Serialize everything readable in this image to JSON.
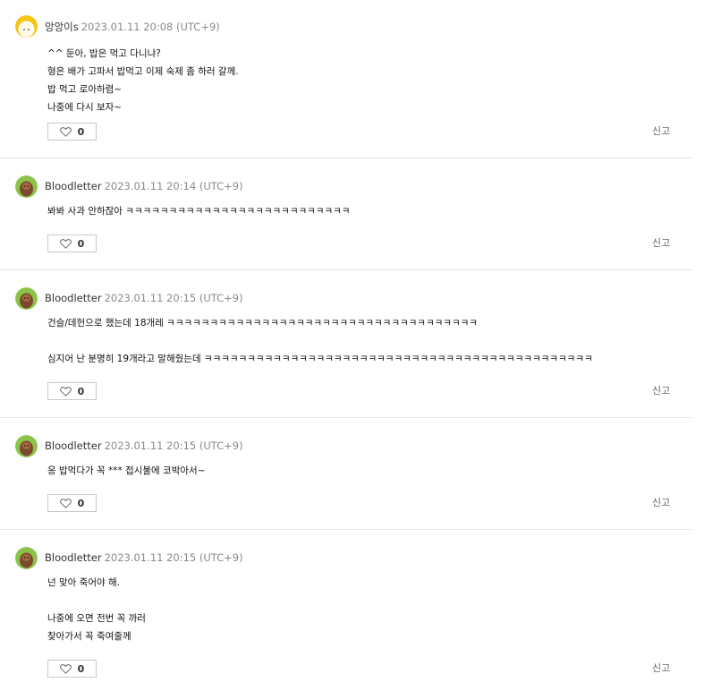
{
  "comments": [
    {
      "author": "앙앙이s",
      "timestamp": "2023.01.11 20:08 (UTC+9)",
      "avatar": "yellow-face-avatar",
      "lines": [
        "^^ 둔아, 밥은 먹고 다니냐?",
        "형은 배가 고파서 밥먹고 이제 숙제 좀 하러 갈께.",
        "밥 먹고 로아하렴~",
        "나중에 다시 보자~"
      ],
      "likes": "0",
      "report": "신고"
    },
    {
      "author": "Bloodletter",
      "timestamp": "2023.01.11 20:14 (UTC+9)",
      "avatar": "brown-character-avatar",
      "lines": [
        "봐봐 사과 안하잖아 ㅋㅋㅋㅋㅋㅋㅋㅋㅋㅋㅋㅋㅋㅋㅋㅋㅋㅋㅋㅋㅋㅋㅋㅋㅋㅋ"
      ],
      "likes": "0",
      "report": "신고"
    },
    {
      "author": "Bloodletter",
      "timestamp": "2023.01.11 20:15 (UTC+9)",
      "avatar": "brown-character-avatar",
      "lines": [
        "건슬/데헌으로 했는데 18개레 ㅋㅋㅋㅋㅋㅋㅋㅋㅋㅋㅋㅋㅋㅋㅋㅋㅋㅋㅋㅋㅋㅋㅋㅋㅋㅋㅋㅋㅋㅋㅋㅋㅋㅋㅋㅋ",
        "",
        "심지어 난 분명히 19개라고 말해줬는데 ㅋㅋㅋㅋㅋㅋㅋㅋㅋㅋㅋㅋㅋㅋㅋㅋㅋㅋㅋㅋㅋㅋㅋㅋㅋㅋㅋㅋㅋㅋㅋㅋㅋㅋㅋㅋㅋㅋㅋㅋㅋㅋㅋㅋㅋ"
      ],
      "likes": "0",
      "report": "신고"
    },
    {
      "author": "Bloodletter",
      "timestamp": "2023.01.11 20:15 (UTC+9)",
      "avatar": "brown-character-avatar",
      "lines": [
        "응 밥먹다가 꼭 *** 접시불에 코박아서~"
      ],
      "likes": "0",
      "report": "신고"
    },
    {
      "author": "Bloodletter",
      "timestamp": "2023.01.11 20:15 (UTC+9)",
      "avatar": "brown-character-avatar",
      "lines": [
        "넌 맞아 죽어야 해.",
        "",
        "나중에 오면 전번 꼭 까러",
        "찾아가서 꼭 죽여줄께"
      ],
      "likes": "0",
      "report": "신고"
    }
  ],
  "colors": {
    "separator": "#e6e6e6",
    "timestamp": "#8a8a8a",
    "like_border": "#c9c9c9"
  }
}
